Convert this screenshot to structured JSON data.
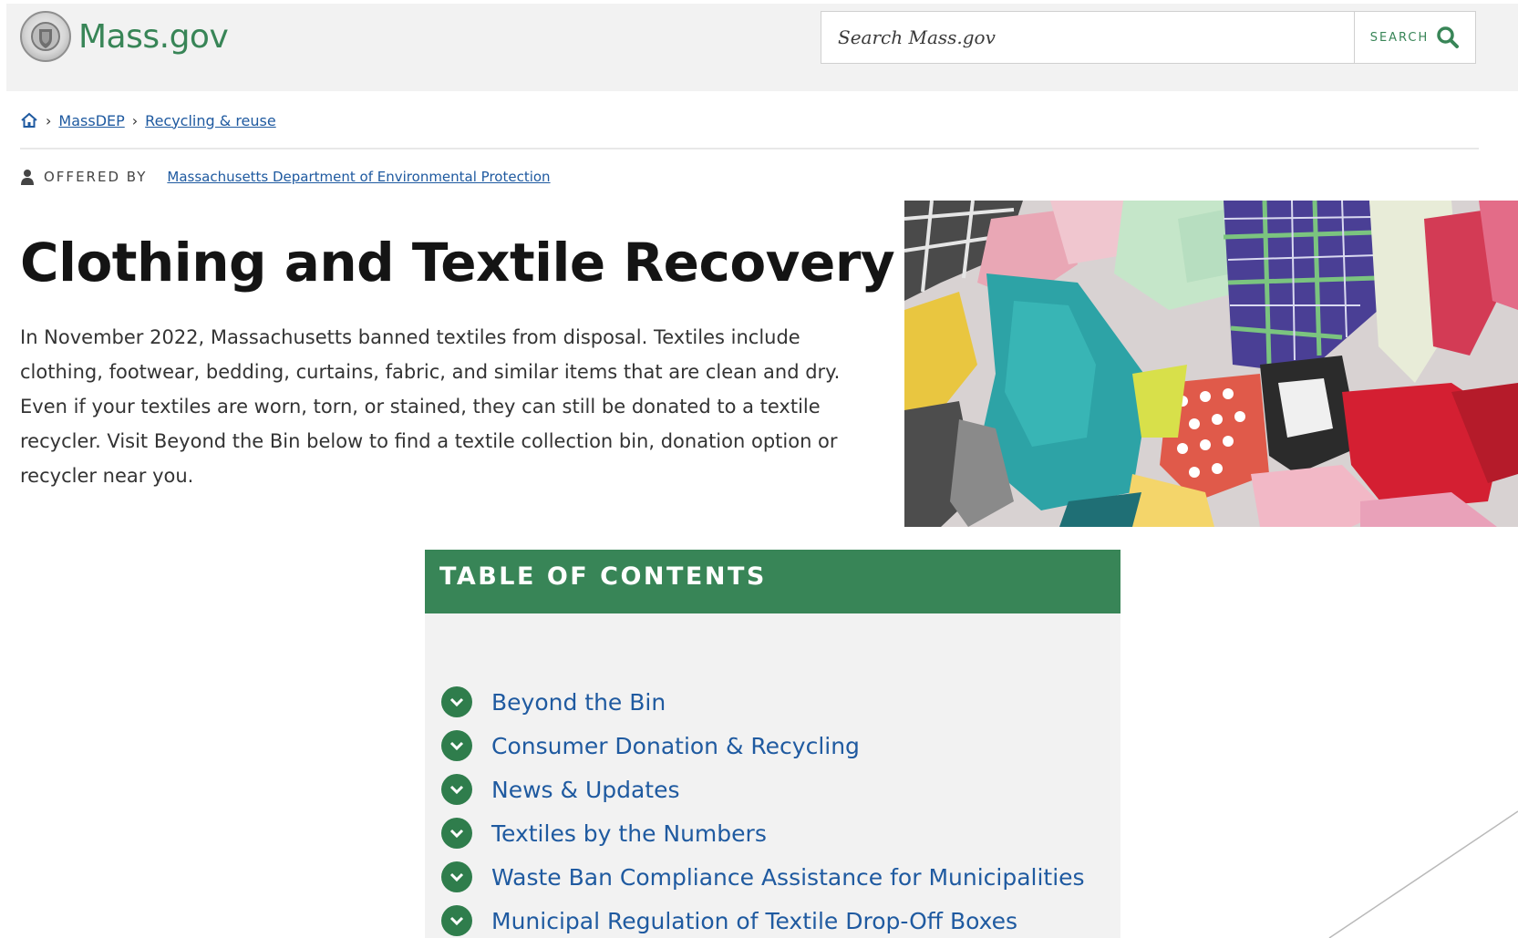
{
  "header": {
    "logo_text": "Mass.gov",
    "search": {
      "placeholder": "Search Mass.gov",
      "button_label": "SEARCH"
    }
  },
  "breadcrumb": {
    "items": [
      "MassDEP",
      "Recycling & reuse"
    ]
  },
  "offered_by": {
    "label": "OFFERED BY",
    "organization": "Massachusetts Department of Environmental Protection"
  },
  "page": {
    "title": "Clothing and Textile Recovery",
    "intro": "In November 2022, Massachusetts banned textiles from disposal. Textiles include clothing, footwear, bedding, curtains, fabric, and similar items that are clean and dry. Even if your textiles are worn, torn, or stained, they can still be donated to a textile recycler. Visit Beyond the Bin below to find a textile collection bin, donation option or recycler near you."
  },
  "toc": {
    "title": "TABLE OF CONTENTS",
    "items": [
      "Beyond the Bin",
      "Consumer Donation & Recycling",
      "News & Updates",
      "Textiles by the Numbers",
      "Waste Ban Compliance Assistance for Municipalities",
      "Municipal Regulation of Textile Drop-Off Boxes"
    ]
  },
  "colors": {
    "brand_green": "#388557",
    "link_blue": "#1f5aa0",
    "header_bg": "#f2f2f2",
    "toc_bg": "#f2f2f2"
  },
  "icons": [
    "seal-icon",
    "search-icon",
    "home-icon",
    "person-icon",
    "chevron-down-icon"
  ]
}
